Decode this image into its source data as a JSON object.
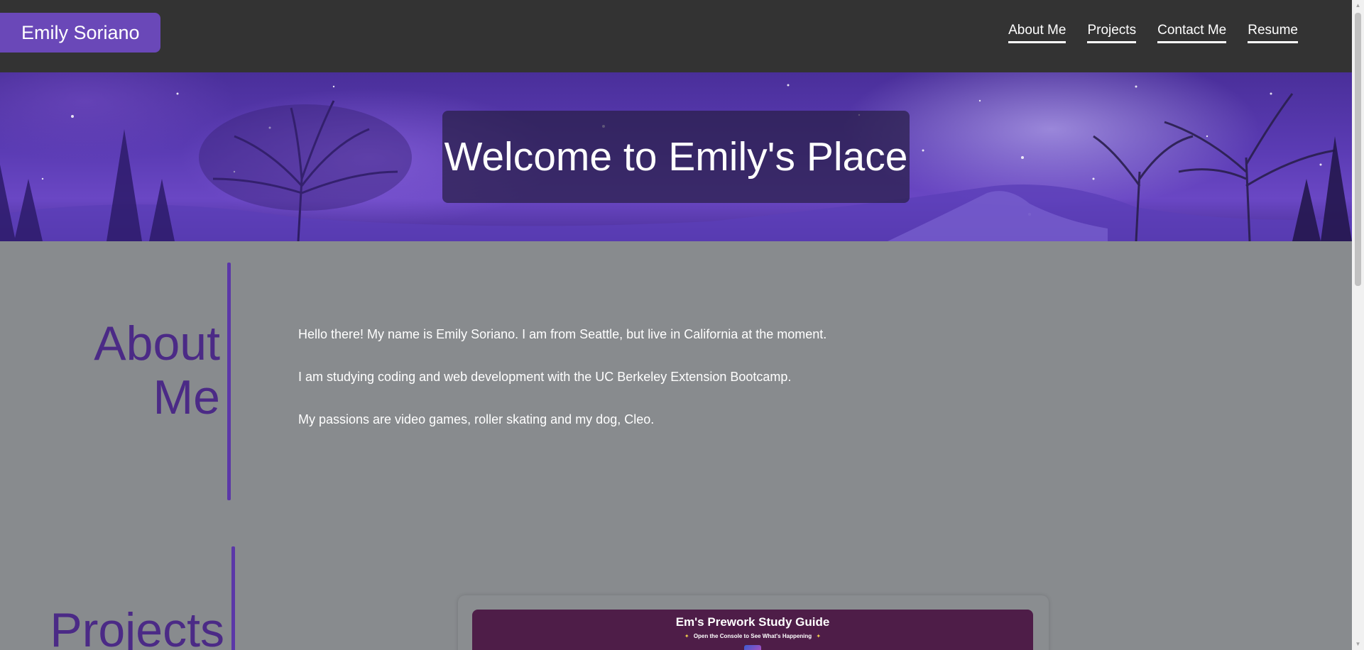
{
  "header": {
    "brand": "Emily Soriano",
    "nav": [
      "About Me",
      "Projects",
      "Contact Me",
      "Resume"
    ]
  },
  "hero": {
    "title": "Welcome to Emily's Place"
  },
  "about": {
    "title_line1": "About",
    "title_line2": "Me",
    "paragraphs": [
      "Hello there! My name is Emily Soriano. I am from Seattle, but live in California at the moment.",
      "I am studying coding and web development with the UC Berkeley Extension Bootcamp.",
      "My passions are video games, roller skating and my dog, Cleo."
    ]
  },
  "projects": {
    "title": "Projects",
    "card": {
      "title": "Em's Prework Study Guide",
      "subtitle": "Open the Console to See What's Happening",
      "star": "✦"
    }
  },
  "colors": {
    "header_bg": "#333333",
    "brand_bg": "#6a48b8",
    "page_bg": "#888b8e",
    "heading": "#4b2a86",
    "accent_bar": "#5b37a8",
    "card_bg": "#4e1d48"
  },
  "icons": {
    "scroll_up": "triangle-up",
    "scroll_down": "triangle-down"
  }
}
